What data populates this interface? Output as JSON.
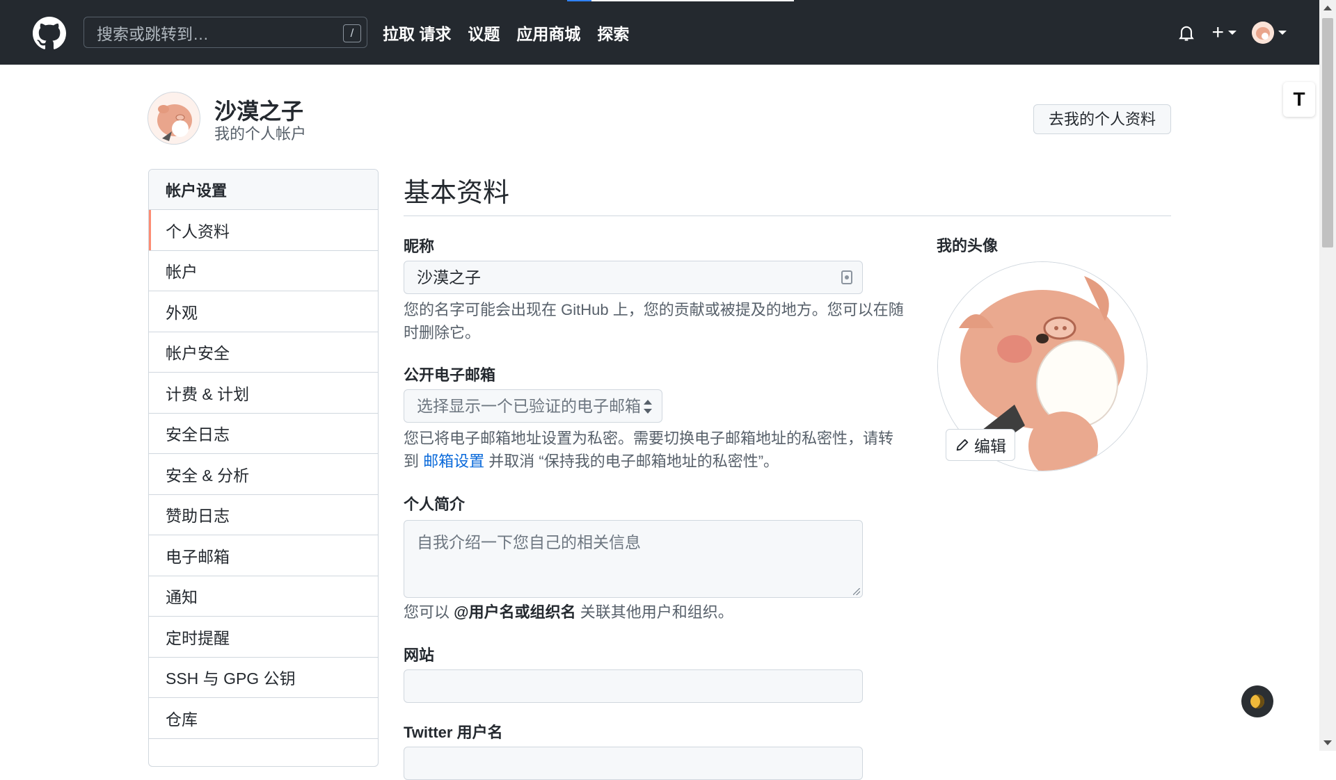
{
  "header": {
    "search_placeholder": "搜索或跳转到…",
    "search_shortcut": "/",
    "nav": [
      "拉取 请求",
      "议题",
      "应用商城",
      "探索"
    ],
    "plus_label": "+"
  },
  "profile": {
    "name": "沙漠之子",
    "subtitle": "我的个人帐户",
    "goto_button": "去我的个人资料"
  },
  "sidebar": {
    "heading": "帐户设置",
    "items": [
      {
        "label": "个人资料",
        "active": true
      },
      {
        "label": "帐户"
      },
      {
        "label": "外观"
      },
      {
        "label": "帐户安全"
      },
      {
        "label": "计费 & 计划"
      },
      {
        "label": "安全日志"
      },
      {
        "label": "安全 & 分析"
      },
      {
        "label": "赞助日志"
      },
      {
        "label": "电子邮箱"
      },
      {
        "label": "通知"
      },
      {
        "label": "定时提醒"
      },
      {
        "label": "SSH 与 GPG 公钥"
      },
      {
        "label": "仓库"
      }
    ]
  },
  "main": {
    "title": "基本资料",
    "nickname": {
      "label": "昵称",
      "value": "沙漠之子",
      "note": "您的名字可能会出现在 GitHub 上，您的贡献或被提及的地方。您可以在随时删除它。"
    },
    "public_email": {
      "label": "公开电子邮箱",
      "select_value": "选择显示一个已验证的电子邮箱",
      "note_before": "您已将电子邮箱地址设置为私密。需要切换电子邮箱地址的私密性，请转到 ",
      "note_link": "邮箱设置",
      "note_after": " 并取消 “保持我的电子邮箱地址的私密性”。"
    },
    "bio": {
      "label": "个人简介",
      "placeholder": "自我介绍一下您自己的相关信息",
      "note_before": "您可以 ",
      "note_strong": "@用户名或组织名",
      "note_after": " 关联其他用户和组织。"
    },
    "website": {
      "label": "网站",
      "value": ""
    },
    "twitter": {
      "label": "Twitter 用户名"
    }
  },
  "avatar_panel": {
    "label": "我的头像",
    "edit_button": "编辑"
  },
  "floating": {
    "translate_label": "T"
  },
  "colors": {
    "header_bg": "#24292f",
    "active_indicator": "#fd8c73",
    "link": "#0969da"
  }
}
